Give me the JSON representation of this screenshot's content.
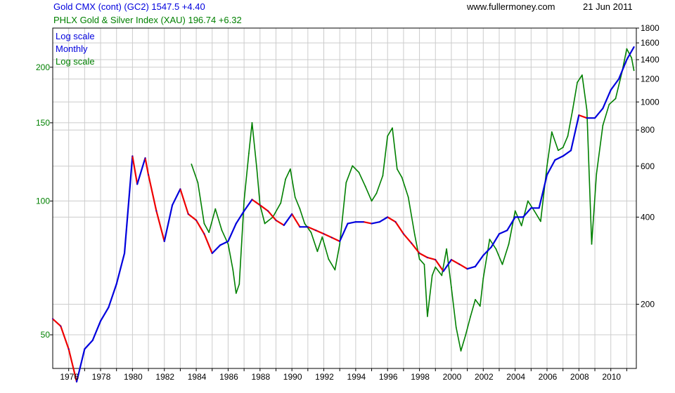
{
  "header": {
    "gold_title": "Gold CMX (cont) (GC2) 1547.5 +4.40",
    "xau_title": "PHLX Gold & Silver Index (XAU) 196.74 +6.32",
    "site": "www.fullermoney.com",
    "date": "21 Jun 2011"
  },
  "legend": {
    "gold_scale": "Log scale",
    "gold_period": "Monthly",
    "xau_scale": "Log scale"
  },
  "colors": {
    "gold_up": "#0000dd",
    "gold_down": "#ee0000",
    "xau": "#008000",
    "grid": "#cccccc",
    "axis": "#000000"
  },
  "chart_data": {
    "type": "line",
    "x_ticks": [
      "1976",
      "1978",
      "1980",
      "1982",
      "1984",
      "1986",
      "1988",
      "1990",
      "1992",
      "1994",
      "1996",
      "1998",
      "2000",
      "2002",
      "2004",
      "2006",
      "2008",
      "2010"
    ],
    "left_axis": {
      "series": "PHLX Gold & Silver Index (XAU)",
      "scale": "log",
      "ticks": [
        50,
        100,
        150,
        200
      ],
      "range": [
        42,
        245
      ]
    },
    "right_axis": {
      "series": "Gold CMX (cont) (GC2)",
      "scale": "log",
      "ticks": [
        200,
        400,
        600,
        800,
        1000,
        1200,
        1400,
        1600,
        1800
      ],
      "range": [
        120,
        1800
      ]
    },
    "grid": true,
    "legend_placement": "top-left",
    "series": [
      {
        "name": "Gold CMX (cont) (GC2)",
        "axis": "right",
        "points": [
          [
            1975.0,
            178
          ],
          [
            1975.5,
            168
          ],
          [
            1976.0,
            140
          ],
          [
            1976.5,
            108
          ],
          [
            1977.0,
            140
          ],
          [
            1977.5,
            150
          ],
          [
            1978.0,
            175
          ],
          [
            1978.5,
            195
          ],
          [
            1979.0,
            235
          ],
          [
            1979.5,
            300
          ],
          [
            1980.0,
            650
          ],
          [
            1980.3,
            520
          ],
          [
            1980.8,
            640
          ],
          [
            1981.0,
            560
          ],
          [
            1981.5,
            420
          ],
          [
            1982.0,
            330
          ],
          [
            1982.5,
            440
          ],
          [
            1983.0,
            500
          ],
          [
            1983.5,
            410
          ],
          [
            1984.0,
            390
          ],
          [
            1984.5,
            350
          ],
          [
            1985.0,
            300
          ],
          [
            1985.5,
            320
          ],
          [
            1986.0,
            330
          ],
          [
            1986.5,
            380
          ],
          [
            1987.0,
            420
          ],
          [
            1987.5,
            460
          ],
          [
            1988.0,
            440
          ],
          [
            1988.5,
            420
          ],
          [
            1989.0,
            390
          ],
          [
            1989.5,
            375
          ],
          [
            1990.0,
            410
          ],
          [
            1990.5,
            370
          ],
          [
            1991.0,
            370
          ],
          [
            1991.5,
            360
          ],
          [
            1992.0,
            350
          ],
          [
            1992.5,
            340
          ],
          [
            1993.0,
            330
          ],
          [
            1993.5,
            380
          ],
          [
            1994.0,
            385
          ],
          [
            1994.5,
            385
          ],
          [
            1995.0,
            380
          ],
          [
            1995.5,
            385
          ],
          [
            1996.0,
            400
          ],
          [
            1996.5,
            385
          ],
          [
            1997.0,
            350
          ],
          [
            1997.5,
            325
          ],
          [
            1998.0,
            300
          ],
          [
            1998.5,
            290
          ],
          [
            1999.0,
            285
          ],
          [
            1999.5,
            260
          ],
          [
            2000.0,
            285
          ],
          [
            2000.5,
            275
          ],
          [
            2001.0,
            265
          ],
          [
            2001.5,
            270
          ],
          [
            2002.0,
            295
          ],
          [
            2002.5,
            315
          ],
          [
            2003.0,
            350
          ],
          [
            2003.5,
            360
          ],
          [
            2004.0,
            400
          ],
          [
            2004.5,
            400
          ],
          [
            2005.0,
            430
          ],
          [
            2005.5,
            430
          ],
          [
            2006.0,
            560
          ],
          [
            2006.5,
            630
          ],
          [
            2007.0,
            650
          ],
          [
            2007.5,
            680
          ],
          [
            2008.0,
            900
          ],
          [
            2008.5,
            880
          ],
          [
            2009.0,
            880
          ],
          [
            2009.5,
            950
          ],
          [
            2010.0,
            1100
          ],
          [
            2010.5,
            1200
          ],
          [
            2011.0,
            1400
          ],
          [
            2011.45,
            1547.5
          ]
        ]
      },
      {
        "name": "PHLX Gold & Silver Index (XAU)",
        "axis": "left",
        "points": [
          [
            1983.7,
            121
          ],
          [
            1984.1,
            110
          ],
          [
            1984.5,
            89
          ],
          [
            1984.8,
            85
          ],
          [
            1985.2,
            96
          ],
          [
            1985.6,
            86
          ],
          [
            1986.0,
            80
          ],
          [
            1986.3,
            70
          ],
          [
            1986.5,
            62
          ],
          [
            1986.7,
            65
          ],
          [
            1987.0,
            100
          ],
          [
            1987.3,
            128
          ],
          [
            1987.5,
            150
          ],
          [
            1987.8,
            118
          ],
          [
            1988.0,
            98
          ],
          [
            1988.3,
            89
          ],
          [
            1988.8,
            92
          ],
          [
            1989.3,
            99
          ],
          [
            1989.6,
            112
          ],
          [
            1989.9,
            118
          ],
          [
            1990.2,
            102
          ],
          [
            1990.5,
            96
          ],
          [
            1990.8,
            89
          ],
          [
            1991.2,
            85
          ],
          [
            1991.6,
            77
          ],
          [
            1991.9,
            83
          ],
          [
            1992.3,
            74
          ],
          [
            1992.7,
            70
          ],
          [
            1993.0,
            80
          ],
          [
            1993.4,
            110
          ],
          [
            1993.8,
            120
          ],
          [
            1994.2,
            116
          ],
          [
            1994.6,
            108
          ],
          [
            1995.0,
            100
          ],
          [
            1995.3,
            104
          ],
          [
            1995.7,
            114
          ],
          [
            1996.0,
            140
          ],
          [
            1996.3,
            146
          ],
          [
            1996.6,
            118
          ],
          [
            1996.9,
            113
          ],
          [
            1997.3,
            102
          ],
          [
            1997.7,
            84
          ],
          [
            1998.0,
            74
          ],
          [
            1998.3,
            72
          ],
          [
            1998.5,
            55
          ],
          [
            1998.8,
            68
          ],
          [
            1999.0,
            71
          ],
          [
            1999.4,
            68
          ],
          [
            1999.7,
            78
          ],
          [
            2000.0,
            64
          ],
          [
            2000.3,
            52
          ],
          [
            2000.6,
            46
          ],
          [
            2000.9,
            50
          ],
          [
            2001.2,
            55
          ],
          [
            2001.5,
            60
          ],
          [
            2001.8,
            58
          ],
          [
            2002.0,
            67
          ],
          [
            2002.4,
            82
          ],
          [
            2002.8,
            78
          ],
          [
            2003.2,
            72
          ],
          [
            2003.6,
            80
          ],
          [
            2004.0,
            95
          ],
          [
            2004.4,
            88
          ],
          [
            2004.8,
            100
          ],
          [
            2005.2,
            95
          ],
          [
            2005.6,
            90
          ],
          [
            2006.0,
            120
          ],
          [
            2006.3,
            143
          ],
          [
            2006.7,
            130
          ],
          [
            2007.0,
            132
          ],
          [
            2007.3,
            140
          ],
          [
            2007.6,
            160
          ],
          [
            2007.9,
            185
          ],
          [
            2008.2,
            192
          ],
          [
            2008.5,
            160
          ],
          [
            2008.8,
            80
          ],
          [
            2009.1,
            115
          ],
          [
            2009.5,
            148
          ],
          [
            2009.9,
            165
          ],
          [
            2010.3,
            170
          ],
          [
            2010.7,
            195
          ],
          [
            2011.0,
            220
          ],
          [
            2011.3,
            210
          ],
          [
            2011.45,
            196.74
          ]
        ]
      }
    ]
  }
}
